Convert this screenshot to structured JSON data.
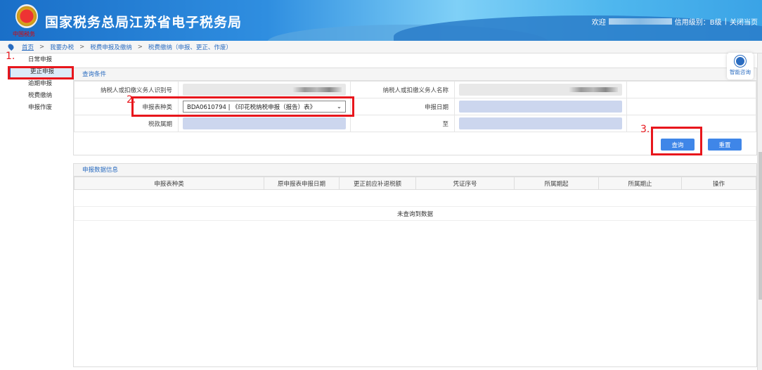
{
  "header": {
    "title": "国家税务总局江苏省电子税务局",
    "logo_text": "中国税务",
    "welcome": "欢迎",
    "credit": "信用级别：B级",
    "close": "关闭当页"
  },
  "breadcrumb": [
    "首页",
    "我要办税",
    "税费申报及缴纳",
    "税费缴纳（申报、更正、作废）"
  ],
  "sidebar": {
    "items": [
      {
        "label": "日常申报"
      },
      {
        "label": "更正申报"
      },
      {
        "label": "逾期申报"
      },
      {
        "label": "税费缴纳"
      },
      {
        "label": "申报作废"
      }
    ]
  },
  "query": {
    "title": "查询条件",
    "taxpayer_id_label": "纳税人或扣缴义务人识别号",
    "taxpayer_name_label": "纳税人或扣缴义务人名称",
    "form_type_label": "申报表种类",
    "form_type_value": "BDA0610794 | 《印花税纳税申报（报告）表》",
    "declare_date_label": "申报日期",
    "tax_period_label": "税款属期",
    "to_label": "至",
    "query_btn": "查询",
    "reset_btn": "重置"
  },
  "data": {
    "title": "申报数据信息",
    "columns": [
      "申报表种类",
      "原申报表申报日期",
      "更正前应补退税额",
      "凭证序号",
      "所属期起",
      "所属期止",
      "操作"
    ],
    "empty": "未查询到数据"
  },
  "help": {
    "label": "智能咨询"
  },
  "annotations": [
    "1.",
    "2.",
    "3."
  ],
  "colors": {
    "accent": "#2a6cc0",
    "button": "#3f86e8",
    "annotation": "#e8161c"
  }
}
